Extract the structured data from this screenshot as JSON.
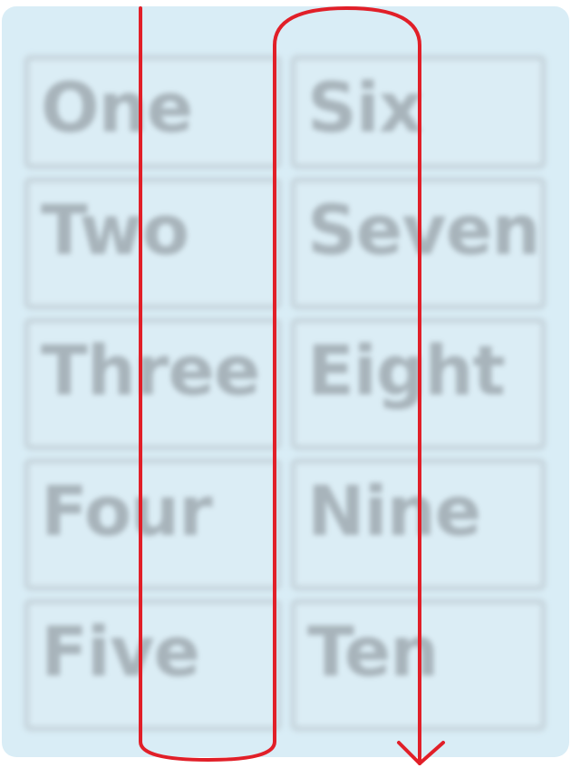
{
  "diagram": {
    "panel_background": "#d9edf6",
    "cell_background": "#dbedf5",
    "cell_border": "#c9d8e0",
    "text_color": "#a8b4bb",
    "line_color": "#e11f28",
    "reading_order": "column-wise, top-to-bottom, then next column"
  },
  "cells": {
    "left_column": [
      "One",
      "Two",
      "Three",
      "Four",
      "Five"
    ],
    "right_column": [
      "Six",
      "Seven",
      "Eight",
      "Nine",
      "Ten"
    ]
  }
}
